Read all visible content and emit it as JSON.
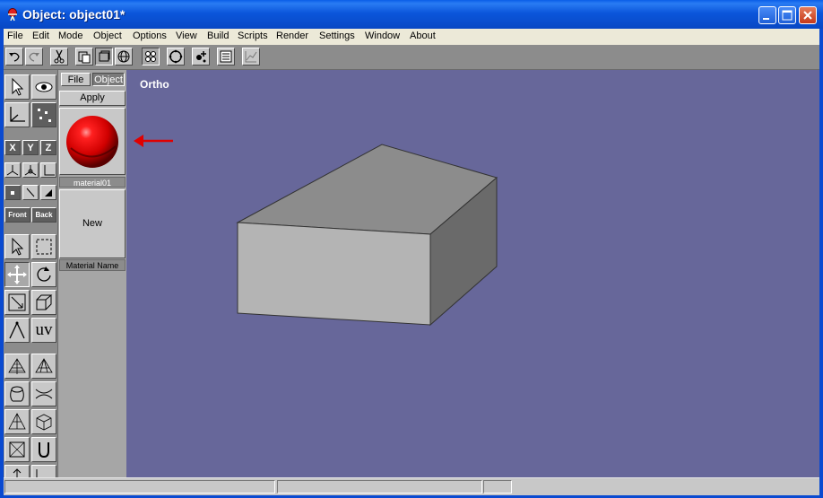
{
  "window": {
    "title": "Object: object01*",
    "buttons": [
      "minimize-icon",
      "maximize-icon",
      "close-icon"
    ]
  },
  "menu": [
    "File",
    "Edit",
    "Mode",
    "Object",
    "Options",
    "View",
    "Build",
    "Scripts",
    "Render",
    "Settings",
    "Window",
    "About"
  ],
  "toolbar": {
    "icons": [
      "undo-icon",
      "redo-icon",
      "cut-icon",
      "paste-icon",
      "copy-icon",
      "globe-icon",
      "vertices-icon",
      "circle-select-icon",
      "add-vertex-icon",
      "list-icon",
      "graph-icon"
    ]
  },
  "left_toolbar": {
    "axis": [
      "X",
      "Y",
      "Z"
    ],
    "view_buttons": [
      "Front",
      "Back"
    ],
    "uv_label": "uv"
  },
  "material_panel": {
    "tabs": [
      "File",
      "Object"
    ],
    "apply_label": "Apply",
    "material_name": "material01",
    "new_label": "New",
    "name_field_label": "Material Name",
    "swatch_color": "#d40000"
  },
  "viewport": {
    "label": "Ortho",
    "background": "#67679a"
  },
  "annotation": {
    "arrow_color": "#e00000"
  }
}
